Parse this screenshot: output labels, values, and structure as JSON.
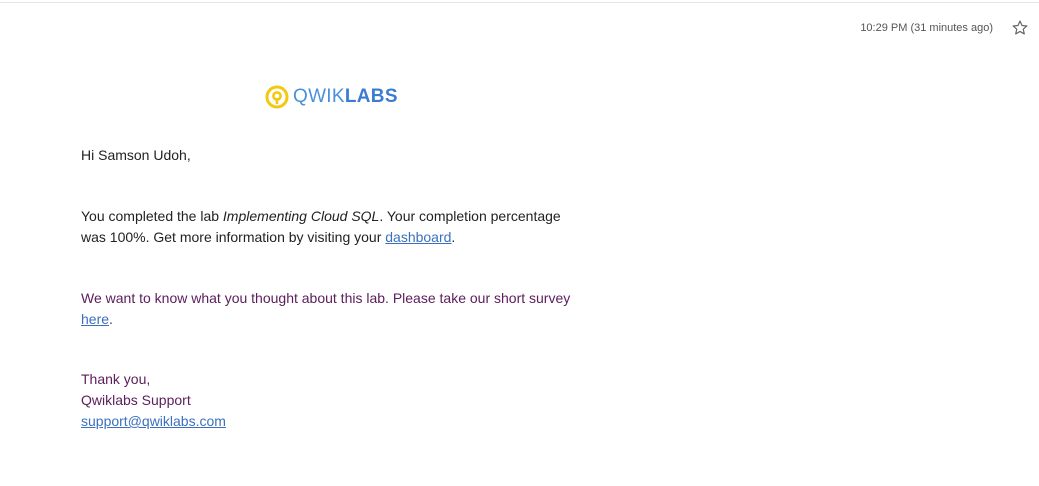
{
  "header": {
    "timestamp": "10:29 PM (31 minutes ago)",
    "star_icon": "star-outline-icon"
  },
  "logo": {
    "text_light": "QWIK",
    "text_bold": "LABS",
    "brand_yellow": "#f2c811",
    "brand_blue": "#3a7cd0"
  },
  "email": {
    "greeting": "Hi Samson Udoh,",
    "completion_prefix": "You completed the lab ",
    "lab_name": "Implementing Cloud SQL",
    "completion_middle": ". Your completion percentage was 100%. Get more information by visiting your ",
    "dashboard_link": "dashboard",
    "completion_suffix": ".",
    "survey_prefix": "We want to know what you thought about this lab. Please take our short survey ",
    "survey_link": "here",
    "survey_suffix": ".",
    "signoff_thanks": "Thank you,",
    "signoff_name": "Qwiklabs Support",
    "signoff_email": "support@qwiklabs.com"
  }
}
